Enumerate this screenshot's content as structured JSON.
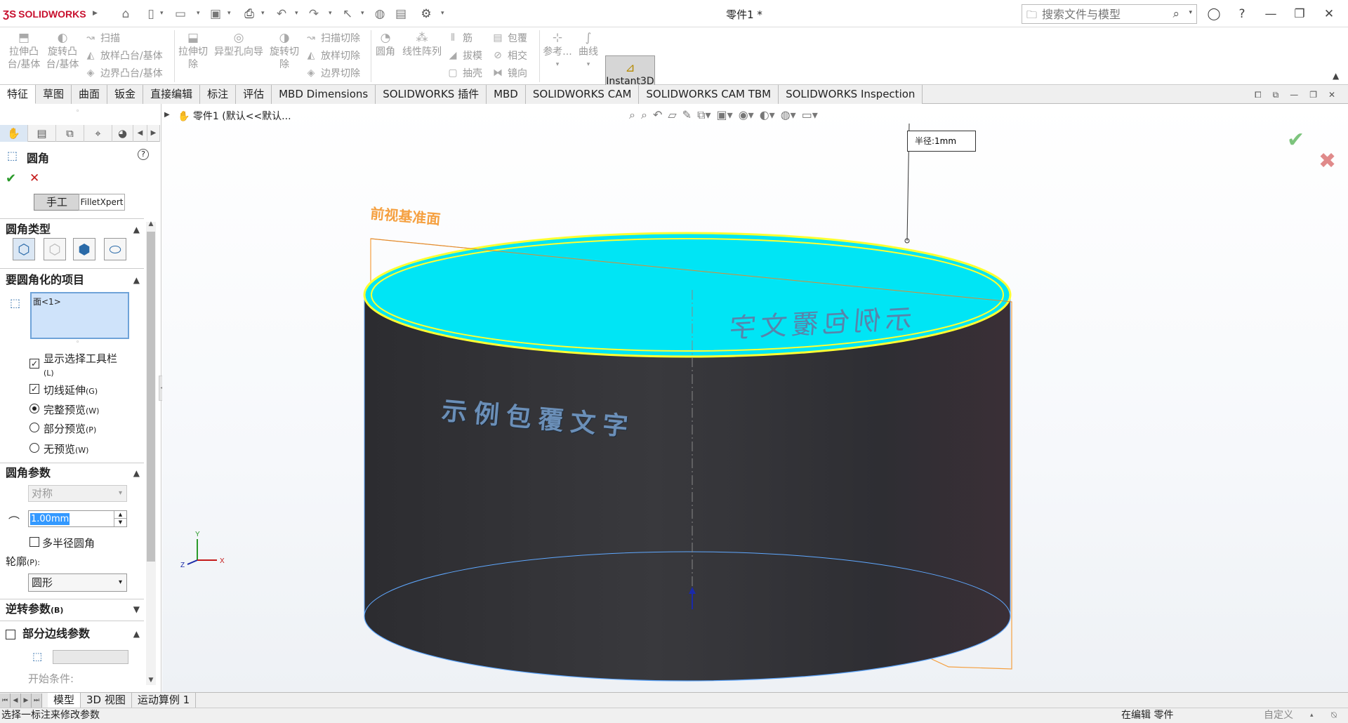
{
  "app": {
    "brand": "SOLIDWORKS",
    "document_title": "零件1 *"
  },
  "search": {
    "placeholder": "搜索文件与模型"
  },
  "ribbon": {
    "extrude_boss": "拉伸凸台/基体",
    "revolve_boss": "旋转凸台/基体",
    "sweep": "扫描",
    "loft": "放样凸台/基体",
    "boundary": "边界凸台/基体",
    "extrude_cut": "拉伸切除",
    "hole_wizard": "异型孔向导",
    "revolve_cut": "旋转切除",
    "sweep_cut": "扫描切除",
    "loft_cut": "放样切除",
    "boundary_cut": "边界切除",
    "fillet": "圆角",
    "linear_pattern": "线性阵列",
    "rib": "筋",
    "draft": "拔模",
    "shell": "抽壳",
    "wrap": "包覆",
    "intersect": "相交",
    "mirror": "镜向",
    "reference": "参考...",
    "curves": "曲线",
    "instant3d": "Instant3D"
  },
  "tabs": [
    "特征",
    "草图",
    "曲面",
    "钣金",
    "直接编辑",
    "标注",
    "评估",
    "MBD Dimensions",
    "SOLIDWORKS 插件",
    "MBD",
    "SOLIDWORKS CAM",
    "SOLIDWORKS CAM TBM",
    "SOLIDWORKS Inspection"
  ],
  "panel": {
    "title": "圆角",
    "mode_manual": "手工",
    "mode_expert": "FilletXpert",
    "fillet_type_header": "圆角类型",
    "items_header": "要圆角化的项目",
    "selected_item": "面<1>",
    "show_toolbar": "显示选择工具栏",
    "show_toolbar_key": "(L)",
    "tangent": "切线延伸",
    "tangent_key": "(G)",
    "full_preview": "完整预览",
    "full_preview_key": "(W)",
    "partial_preview": "部分预览",
    "partial_preview_key": "(P)",
    "no_preview": "无预览",
    "no_preview_key": "(W)",
    "params_header": "圆角参数",
    "symmetric": "对称",
    "radius_value": "1.00mm",
    "multi_radius": "多半径圆角",
    "profile_label": "轮廓",
    "profile_key": "(P):",
    "profile_value": "圆形",
    "setback_header": "逆转参数",
    "setback_key": "(B)",
    "partial_edge_header": "部分边线参数",
    "start_condition": "开始条件:"
  },
  "viewport": {
    "breadcrumb": "零件1  (默认<<默认...",
    "radius_label": "半径:",
    "radius_value": "1mm",
    "plane_label": "前视基准面",
    "wrap_text_back": "示例包覆文字",
    "wrap_text_front": "示例包覆文字"
  },
  "bottom_tabs": [
    "模型",
    "3D 视图",
    "运动算例 1"
  ],
  "status": {
    "left": "选择一标注来修改参数",
    "mid": "在编辑 零件",
    "right": "自定义"
  },
  "colors": {
    "cylinder_body": "#2b2b2f",
    "top_face": "#00e5f5",
    "edge_highlight": "#ffff33",
    "plane": "#f5a040"
  }
}
